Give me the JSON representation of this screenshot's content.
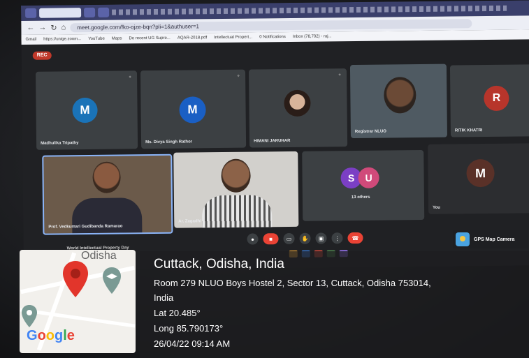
{
  "browser": {
    "url": "meet.google.com/fko-ojze-bqn?pli=1&authuser=1",
    "bookmarks": [
      "Gmail",
      "https://unige.zoom...",
      "YouTube",
      "Maps",
      "Do recent UG Supre...",
      "AQAR-2018.pdf",
      "Intellectual Propert...",
      "0 Notifications",
      "Inbox (78,702) - raj..."
    ]
  },
  "meet": {
    "rec_label": "REC",
    "participants": [
      {
        "name": "Madhulika Tripathy",
        "initial": "M",
        "color": "#1a73b8"
      },
      {
        "name": "Ms. Divya Singh Rathor",
        "initial": "M",
        "color": "#1a5fc4"
      },
      {
        "name": "HIMANI JARUHAR",
        "initial": "",
        "color": "#3c4043"
      },
      {
        "name": "Registrar NLUO",
        "initial": "",
        "color": "#3c4043"
      },
      {
        "name": "RITIK KHATRI",
        "initial": "R",
        "color": "#b7352b"
      },
      {
        "name": "Prof. Vedkumari Gudibanda Ramarao",
        "initial": "",
        "color": "#3c4043"
      },
      {
        "name": "Ar. Zagadhi",
        "initial": "",
        "color": "#3c4043"
      },
      {
        "name": "13 others",
        "initial": "S U",
        "color": "#7b3fc4"
      },
      {
        "name": "You",
        "initial": "M",
        "color": "#5a3128"
      }
    ],
    "meeting_title": "World Intellectual Property Day"
  },
  "gps": {
    "app_label": "GPS Map Camera",
    "city": "Cuttack, Odisha, India",
    "address_line1": "Room 279 NLUO Boys Hostel 2, Sector 13, Cuttack, Odisha 753014,",
    "address_line2": "India",
    "lat": "Lat 20.485°",
    "long": "Long 85.790173°",
    "datetime": "26/04/22 09:14 AM",
    "map_label": "Odisha",
    "map_brand": "Google"
  }
}
